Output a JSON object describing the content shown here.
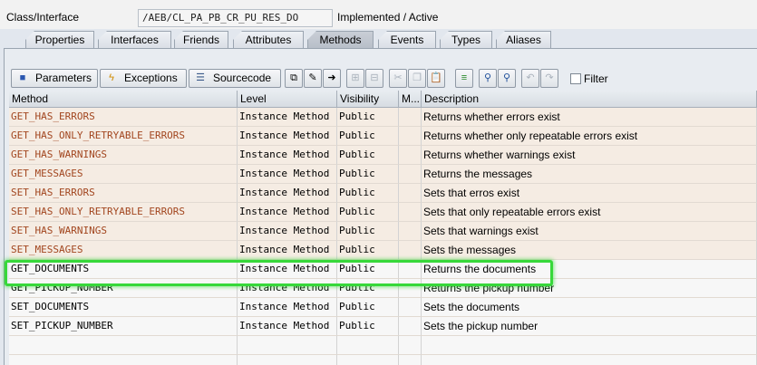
{
  "header": {
    "label": "Class/Interface",
    "class_name": "/AEB/CL_PA_PB_CR_PU_RES_DO",
    "status": "Implemented / Active"
  },
  "tabs": [
    {
      "label": "Properties"
    },
    {
      "label": "Interfaces"
    },
    {
      "label": "Friends"
    },
    {
      "label": "Attributes"
    },
    {
      "label": "Methods"
    },
    {
      "label": "Events"
    },
    {
      "label": "Types"
    },
    {
      "label": "Aliases"
    }
  ],
  "active_tab": "Methods",
  "toolbar": {
    "parameters_label": "Parameters",
    "exceptions_label": "Exceptions",
    "sourcecode_label": "Sourcecode",
    "filter_label": "Filter"
  },
  "table": {
    "columns": [
      "Method",
      "Level",
      "Visibility",
      "M...",
      "Description"
    ],
    "rows": [
      {
        "method": "GET_HAS_ERRORS",
        "level": "Instance Method",
        "visibility": "Public",
        "m": "",
        "description": "Returns whether errors exist"
      },
      {
        "method": "GET_HAS_ONLY_RETRYABLE_ERRORS",
        "level": "Instance Method",
        "visibility": "Public",
        "m": "",
        "description": "Returns whether only repeatable errors exist"
      },
      {
        "method": "GET_HAS_WARNINGS",
        "level": "Instance Method",
        "visibility": "Public",
        "m": "",
        "description": "Returns whether warnings exist"
      },
      {
        "method": "GET_MESSAGES",
        "level": "Instance Method",
        "visibility": "Public",
        "m": "",
        "description": "Returns the messages"
      },
      {
        "method": "SET_HAS_ERRORS",
        "level": "Instance Method",
        "visibility": "Public",
        "m": "",
        "description": "Sets that erros exist"
      },
      {
        "method": "SET_HAS_ONLY_RETRYABLE_ERRORS",
        "level": "Instance Method",
        "visibility": "Public",
        "m": "",
        "description": "Sets that only repeatable errors exist"
      },
      {
        "method": "SET_HAS_WARNINGS",
        "level": "Instance Method",
        "visibility": "Public",
        "m": "",
        "description": "Sets that warnings exist"
      },
      {
        "method": "SET_MESSAGES",
        "level": "Instance Method",
        "visibility": "Public",
        "m": "",
        "description": "Sets the messages"
      },
      {
        "method": "GET_DOCUMENTS",
        "level": "Instance Method",
        "visibility": "Public",
        "m": "",
        "description": "Returns the documents"
      },
      {
        "method": "GET_PICKUP_NUMBER",
        "level": "Instance Method",
        "visibility": "Public",
        "m": "",
        "description": "Returns the pickup number"
      },
      {
        "method": "SET_DOCUMENTS",
        "level": "Instance Method",
        "visibility": "Public",
        "m": "",
        "description": "Sets the documents"
      },
      {
        "method": "SET_PICKUP_NUMBER",
        "level": "Instance Method",
        "visibility": "Public",
        "m": "",
        "description": "Sets the pickup number"
      }
    ]
  },
  "colors": {
    "method_link": "#a2461f",
    "highlight": "#37d83a",
    "row_alt": "#f5ece3"
  }
}
